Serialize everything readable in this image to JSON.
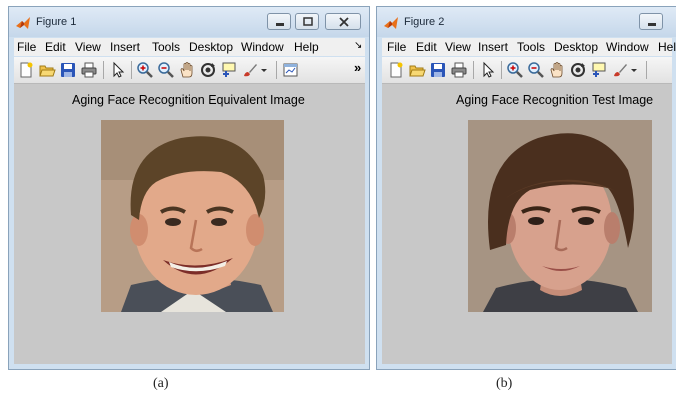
{
  "figures": [
    {
      "title": "Figure 1",
      "menu": [
        "File",
        "Edit",
        "View",
        "Insert",
        "Tools",
        "Desktop",
        "Window",
        "Help"
      ],
      "menu_overflow": "↘",
      "toolbar_overflow": "»",
      "axes_title": "Aging Face Recognition Equivalent Image",
      "image": "smiling-man-face",
      "caption": "(a)"
    },
    {
      "title": "Figure 2",
      "menu": [
        "File",
        "Edit",
        "View",
        "Insert",
        "Tools",
        "Desktop",
        "Window",
        "Hel"
      ],
      "axes_title": "Aging Face Recognition Test Image",
      "image": "young-man-face",
      "caption": "(b)"
    }
  ],
  "toolbar_icons": [
    "new-figure-icon",
    "open-file-icon",
    "save-icon",
    "print-icon",
    "pointer-icon",
    "zoom-in-icon",
    "zoom-out-icon",
    "pan-hand-icon",
    "rotate-3d-icon",
    "data-cursor-icon",
    "brush-icon",
    "dropdown-arrow-icon",
    "plot-tools-icon"
  ],
  "colors": {
    "window_frame": "#cfe0f0",
    "canvas_background": "#c8c8c8",
    "menubar": "#f0f0f0",
    "matlab_logo": "#e8701a"
  }
}
